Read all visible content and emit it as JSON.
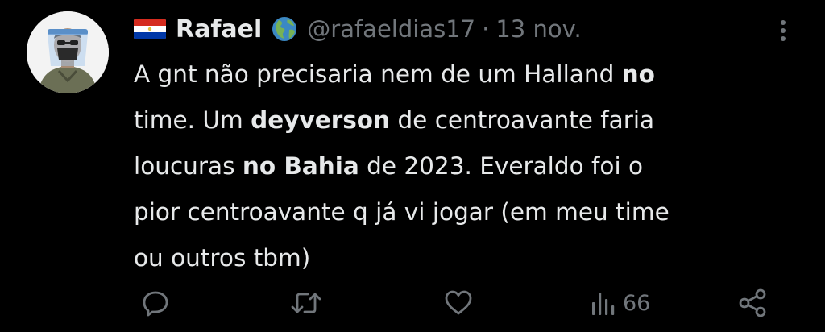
{
  "tweet": {
    "author": {
      "flag_icon": "paraguay-flag-icon",
      "display_name": "Rafael",
      "badge_icon": "globe-americas-icon",
      "handle": "@rafaeldias17",
      "separator": "·",
      "date": "13 nov."
    },
    "body": {
      "lines": [
        [
          {
            "text": "A gnt não precisaria nem de um Halland ",
            "bold": false
          },
          {
            "text": "no",
            "bold": true
          }
        ],
        [
          {
            "text": "time. Um ",
            "bold": false
          },
          {
            "text": "deyverson",
            "bold": true
          },
          {
            "text": " de centroavante faria",
            "bold": false
          }
        ],
        [
          {
            "text": "loucuras ",
            "bold": false
          },
          {
            "text": "no Bahia",
            "bold": true
          },
          {
            "text": " de 2023. Everaldo foi o",
            "bold": false
          }
        ],
        [
          {
            "text": "pior centroavante q já vi jogar (em meu time",
            "bold": false
          }
        ],
        [
          {
            "text": "ou outros tbm)",
            "bold": false
          }
        ]
      ]
    },
    "actions": {
      "reply_icon": "reply-bubble-icon",
      "retweet_icon": "retweet-icon",
      "like_icon": "heart-icon",
      "views_icon": "views-bar-chart-icon",
      "views_count": "66",
      "share_icon": "share-icon"
    },
    "more_icon": "more-vertical-icon"
  },
  "colors": {
    "background": "#000000",
    "text_primary": "#e7e9ea",
    "text_secondary": "#71767b"
  }
}
